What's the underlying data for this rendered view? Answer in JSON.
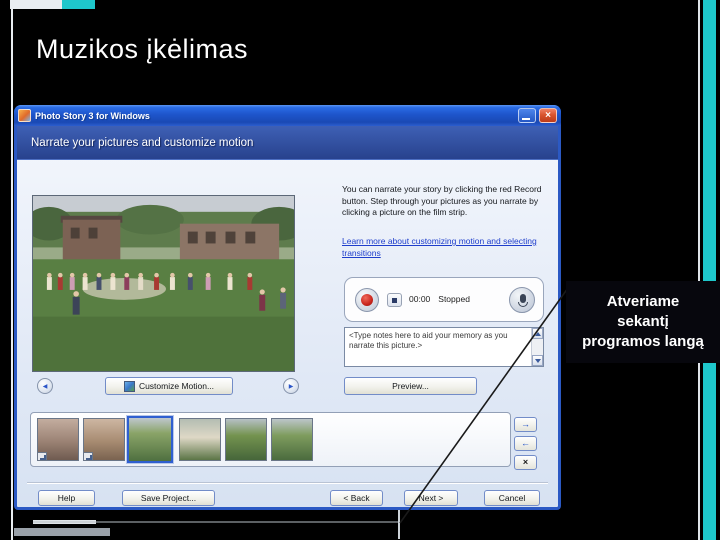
{
  "slide": {
    "title": "Muzikos įkėlimas",
    "callout": {
      "lines": [
        "Atveriame",
        "sekantį",
        "programos langą"
      ]
    }
  },
  "app": {
    "window_title": "Photo Story 3 for Windows",
    "page_header": "Narrate your pictures and customize motion",
    "instructions": "You can narrate your story by clicking the red Record button. Step through your pictures as you narrate by clicking a picture on the film strip.",
    "learn_more_link": "Learn more about customizing motion and selecting transitions",
    "recorder": {
      "time": "00:00",
      "status": "Stopped"
    },
    "notes_hint": "<Type notes here to aid your memory as you narrate this picture.>",
    "buttons": {
      "preview": "Preview...",
      "customize_motion": "Customize Motion...",
      "help": "Help",
      "save_project": "Save Project...",
      "back": "< Back",
      "next": "Next >",
      "cancel": "Cancel"
    },
    "icons": {
      "minimize": "minimize-bar",
      "close": "×",
      "prev_picture": "◀",
      "next_picture": "▶",
      "move_forward": "→",
      "move_backward": "←",
      "remove_picture": "×"
    },
    "film_strip": {
      "count": 6,
      "selected_index": 3
    }
  },
  "colors": {
    "accent_cyan": "#1ec7cb",
    "titlebar_blue": "#1e55cb",
    "header_blue": "#2c4891",
    "link_blue": "#1f3ecc",
    "record_red": "#c9251d",
    "selection_blue": "#2f5fd0"
  }
}
